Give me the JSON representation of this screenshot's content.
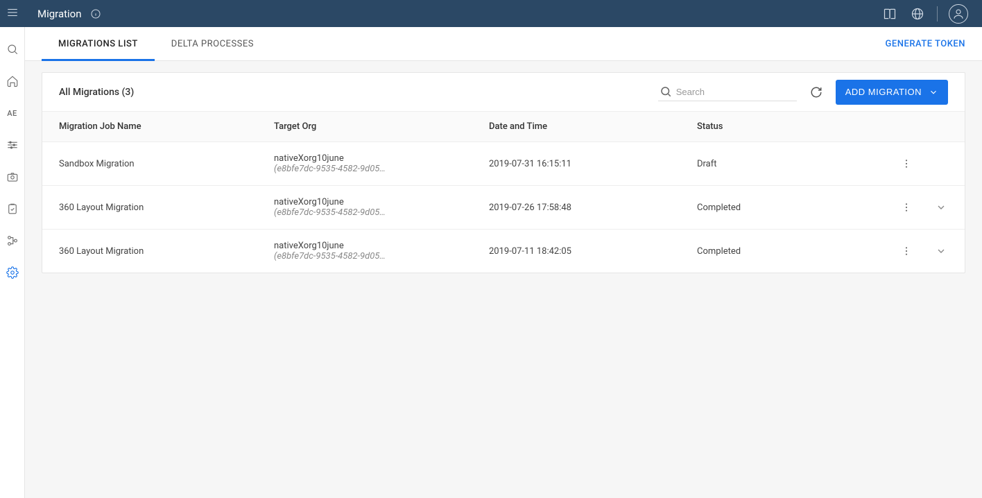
{
  "header": {
    "title": "Migration"
  },
  "sidebar": {
    "ae_label": "AE"
  },
  "tabs": {
    "items": [
      {
        "label": "MIGRATIONS LIST",
        "active": true
      },
      {
        "label": "DELTA PROCESSES",
        "active": false
      }
    ],
    "right_action_label": "GENERATE TOKEN"
  },
  "card": {
    "title": "All Migrations (3)",
    "search_placeholder": "Search",
    "add_button_label": "ADD MIGRATION"
  },
  "table": {
    "columns": {
      "name": "Migration Job Name",
      "org": "Target Org",
      "date": "Date and Time",
      "status": "Status"
    },
    "rows": [
      {
        "name": "Sandbox Migration",
        "org_name": "nativeXorg10june",
        "org_id": "(e8bfe7dc-9535-4582-9d05…",
        "date": "2019-07-31 16:15:11",
        "status": "Draft",
        "expandable": false
      },
      {
        "name": "360 Layout Migration",
        "org_name": "nativeXorg10june",
        "org_id": "(e8bfe7dc-9535-4582-9d05…",
        "date": "2019-07-26 17:58:48",
        "status": "Completed",
        "expandable": true
      },
      {
        "name": "360 Layout Migration",
        "org_name": "nativeXorg10june",
        "org_id": "(e8bfe7dc-9535-4582-9d05…",
        "date": "2019-07-11 18:42:05",
        "status": "Completed",
        "expandable": true
      }
    ]
  }
}
